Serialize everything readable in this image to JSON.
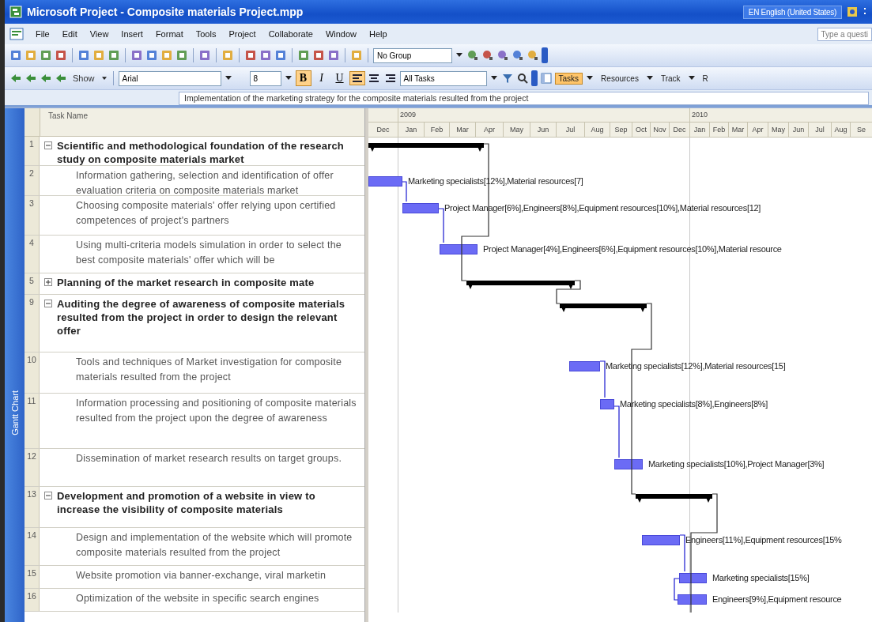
{
  "window": {
    "title": "Microsoft Project - Composite materials Project.mpp",
    "language": "EN English (United States)",
    "help_search": "Type a questi"
  },
  "menu": [
    "File",
    "Edit",
    "View",
    "Insert",
    "Format",
    "Tools",
    "Project",
    "Collaborate",
    "Window",
    "Help"
  ],
  "toolbar": {
    "group": "No Group"
  },
  "formatting": {
    "show": "Show",
    "font": "Arial",
    "size": "8",
    "bold": "B",
    "italic": "I",
    "underline": "U",
    "filter": "All Tasks"
  },
  "guide": [
    {
      "label": "Tasks",
      "selected": true
    },
    {
      "label": "Resources",
      "selected": false
    },
    {
      "label": "Track",
      "selected": false
    },
    {
      "label": "R",
      "selected": false
    }
  ],
  "entry_bar": "Implementation of the marketing strategy for the composite materials resulted from the project",
  "view_bar": "Gantt Chart",
  "table": {
    "column": "Task Name"
  },
  "timescale": {
    "years": [
      "2009",
      "2010"
    ],
    "months": [
      "Dec",
      "Jan",
      "Feb",
      "Mar",
      "Apr",
      "May",
      "Jun",
      "Jul",
      "Aug",
      "Sep",
      "Oct",
      "Nov",
      "Dec",
      "Jan",
      "Feb",
      "Mar",
      "Apr",
      "May",
      "Jun",
      "Jul",
      "Aug",
      "Se"
    ]
  },
  "tasks": [
    {
      "id": "1",
      "name": "Scientific and methodological foundation of the research study on composite materials market",
      "kind": "summary",
      "expanded": true,
      "children": [
        {
          "id": "2",
          "name": "Information gathering, selection and identification of offer evaluation criteria on composite materials market",
          "kind": "task",
          "resources": "Marketing specialists[12%],Material resources[7]"
        },
        {
          "id": "3",
          "name": "Choosing composite materials' offer relying upon certified competences of project's partners",
          "kind": "task",
          "resources": "Project Manager[6%],Engineers[8%],Equipment resources[10%],Material resources[12]"
        },
        {
          "id": "4",
          "name": "Using multi-criteria models simulation in order to select the best composite materials' offer which will be",
          "kind": "task",
          "resources": "Project Manager[4%],Engineers[6%],Equipment resources[10%],Material resource"
        }
      ]
    },
    {
      "id": "5",
      "name": "Planning of the market research in composite mate",
      "kind": "summary",
      "expanded": false
    },
    {
      "id": "9",
      "name": "Auditing the degree of awareness of composite materials resulted from the project in order to design the relevant offer",
      "kind": "summary",
      "expanded": true,
      "children": [
        {
          "id": "10",
          "name": "Tools and techniques of Market investigation for composite materials resulted from the project",
          "kind": "task",
          "resources": "Marketing specialists[12%],Material resources[15]"
        },
        {
          "id": "11",
          "name": "Information processing and positioning of composite materials resulted from the project upon the degree of awareness",
          "kind": "task",
          "resources": "Marketing specialists[8%],Engineers[8%]"
        },
        {
          "id": "12",
          "name": "Dissemination of market research results on target groups.",
          "kind": "task",
          "resources": "Marketing specialists[10%],Project Manager[3%]"
        }
      ]
    },
    {
      "id": "13",
      "name": "Development and promotion of a website in view to increase the visibility of composite materials",
      "kind": "summary",
      "expanded": true,
      "children": [
        {
          "id": "14",
          "name": "Design and implementation of the website which will promote composite materials resulted from the project",
          "kind": "task",
          "resources": "Engineers[11%],Equipment resources[15%"
        },
        {
          "id": "15",
          "name": "Website promotion via banner-exchange, viral marketin",
          "kind": "task",
          "resources": "Marketing specialists[15%]"
        },
        {
          "id": "16",
          "name": "Optimization of the website in specific search engines",
          "kind": "task",
          "resources": "Engineers[9%],Equipment resource"
        }
      ]
    }
  ]
}
